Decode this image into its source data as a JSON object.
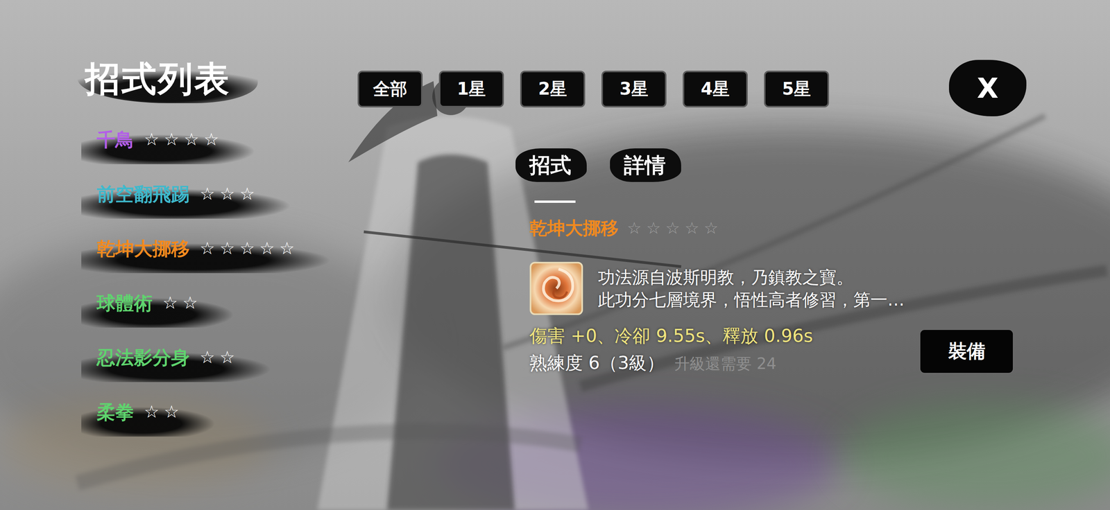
{
  "title": "招式列表",
  "filters": [
    {
      "label": "全部",
      "selected": false
    },
    {
      "label": "1星",
      "selected": false
    },
    {
      "label": "2星",
      "selected": false
    },
    {
      "label": "3星",
      "selected": false
    },
    {
      "label": "4星",
      "selected": false
    },
    {
      "label": "5星",
      "selected": false
    }
  ],
  "close_button": "X",
  "skills": [
    {
      "name": "千鳥",
      "rating": "☆☆☆☆",
      "color": "#b35ee8"
    },
    {
      "name": "前空翻飛踢",
      "rating": "☆☆☆",
      "color": "#3fb9cc"
    },
    {
      "name": "乾坤大挪移",
      "rating": "☆☆☆☆☆",
      "color": "#f28a1e"
    },
    {
      "name": "球體術",
      "rating": "☆☆",
      "color": "#5fd46e"
    },
    {
      "name": "忍法影分身",
      "rating": "☆☆",
      "color": "#5fd46e"
    },
    {
      "name": "柔拳",
      "rating": "☆☆",
      "color": "#5fd46e"
    }
  ],
  "detail_tabs": [
    {
      "label": "招式",
      "selected": true
    },
    {
      "label": "詳情",
      "selected": false
    }
  ],
  "detail": {
    "name": "乾坤大挪移",
    "rating": "☆☆☆☆☆",
    "color": "#f28a1e",
    "description": [
      "功法源自波斯明教，乃鎮教之寶。",
      "此功分七層境界，悟性高者修習，第一…"
    ],
    "stats": "傷害 +0、冷卻 9.55s、釋放 0.96s",
    "proficiency": "熟練度 6（3級）",
    "upgrade_hint": "升級還需要 24",
    "equip_button": "裝備"
  }
}
